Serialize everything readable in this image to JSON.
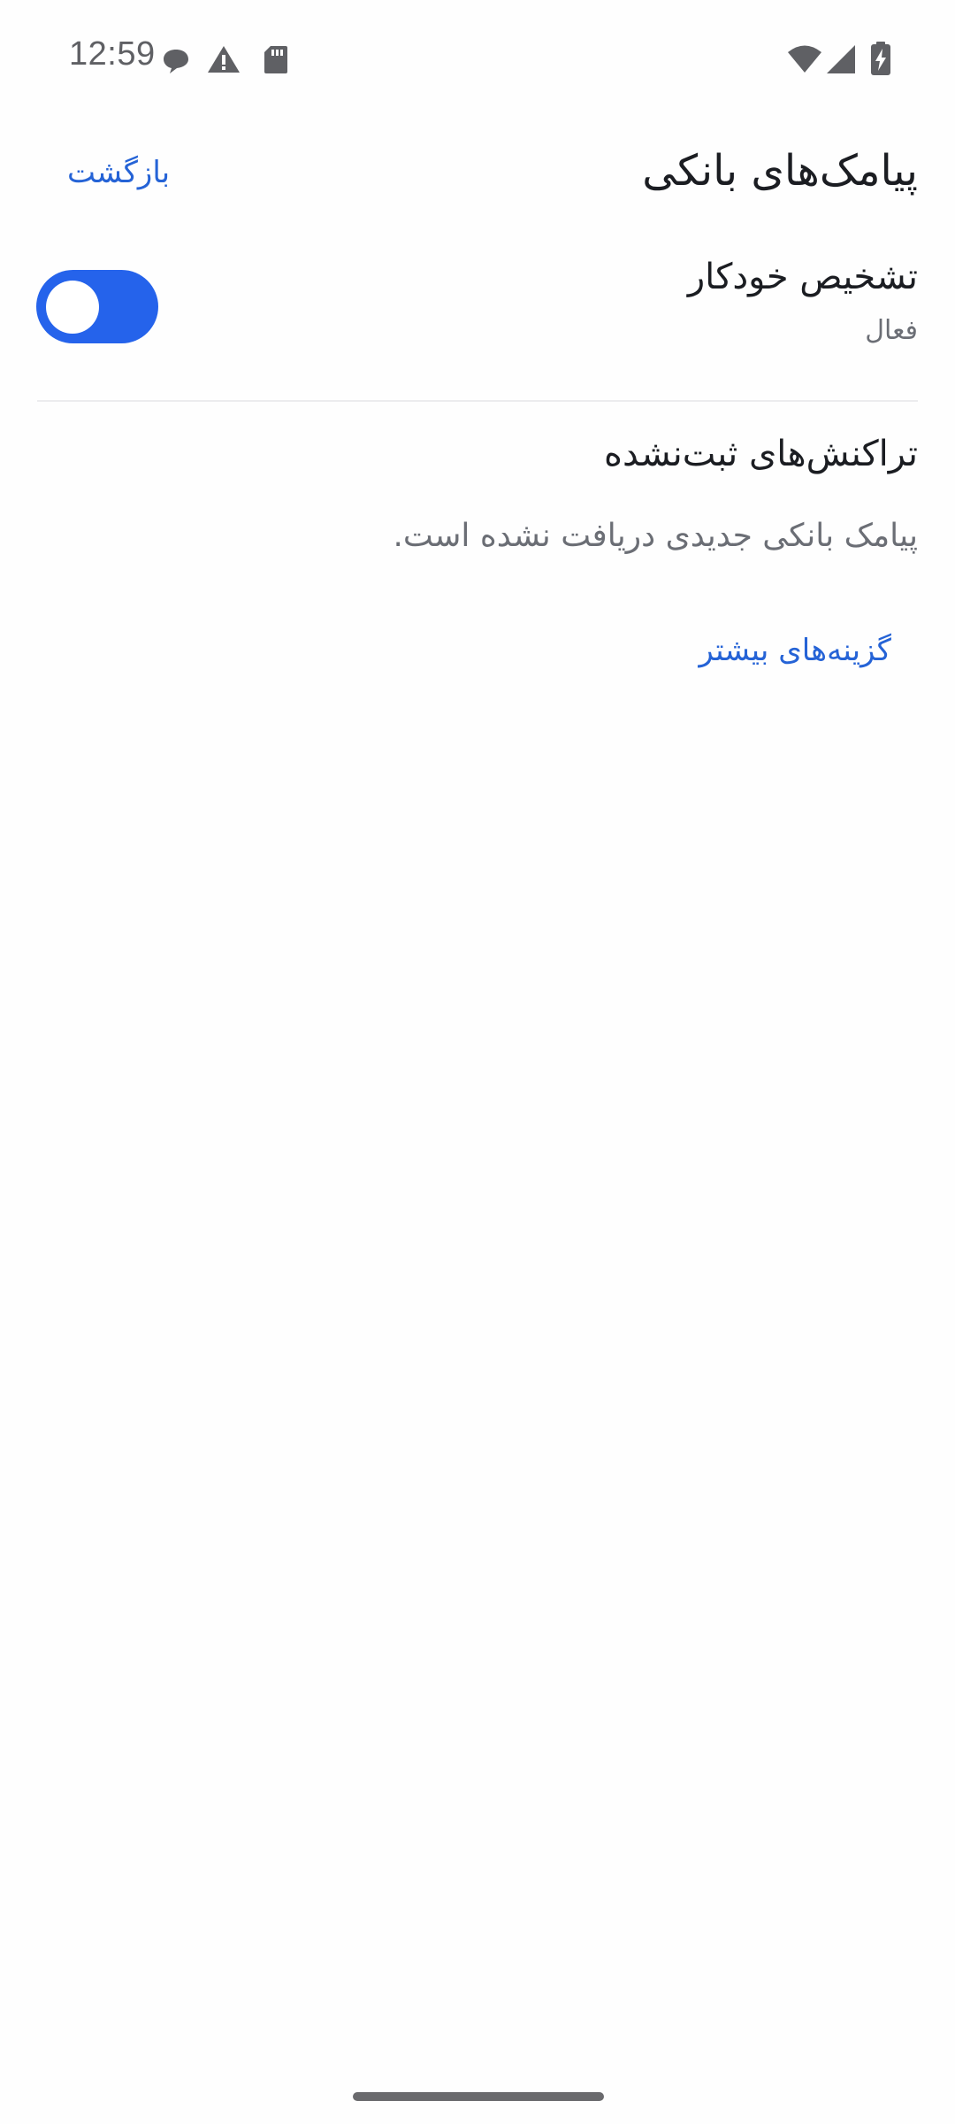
{
  "status_bar": {
    "time": "12:59",
    "left_icons": [
      "chat-bubble-icon",
      "warning-icon",
      "sd-card-icon"
    ],
    "right_icons": [
      "wifi-icon",
      "cell-signal-icon",
      "battery-charging-icon"
    ]
  },
  "header": {
    "title": "پیامک‌های بانکی",
    "back_label": "بازگشت"
  },
  "auto_detect": {
    "title": "تشخیص خودکار",
    "status": "فعال",
    "enabled": true
  },
  "unrecorded": {
    "title": "تراکنش‌های ثبت‌نشده",
    "empty_message": "پیامک بانکی جدیدی دریافت نشده است.",
    "more_label": "گزینه‌های بیشتر"
  },
  "colors": {
    "accent": "#2563eb",
    "link": "#2563d6",
    "text_primary": "#1b1d22",
    "text_secondary": "#6b6e75"
  }
}
